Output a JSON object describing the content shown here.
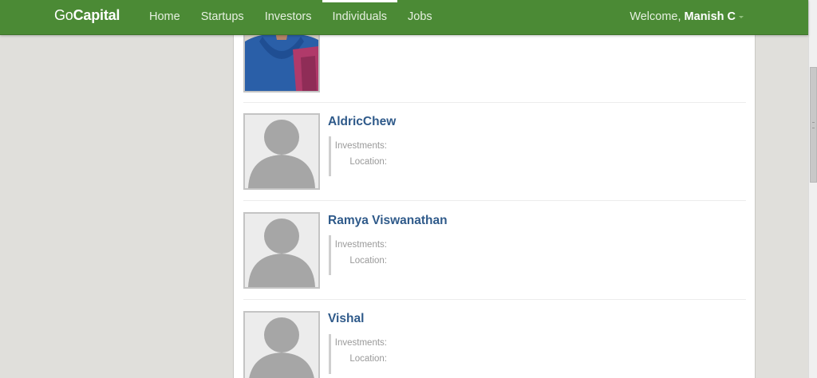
{
  "nav": {
    "brand_prefix": "Go",
    "brand_suffix": "Capital",
    "links": [
      {
        "label": "Home"
      },
      {
        "label": "Startups"
      },
      {
        "label": "Investors"
      },
      {
        "label": "Individuals",
        "active": true
      },
      {
        "label": "Jobs"
      }
    ],
    "welcome_text": "Welcome,",
    "user_name": "Manish C"
  },
  "people": [
    {
      "name": "AldricChew",
      "investments_label": "Investments:",
      "location_label": "Location:"
    },
    {
      "name": "Ramya Viswanathan",
      "investments_label": "Investments:",
      "location_label": "Location:"
    },
    {
      "name": "Vishal",
      "investments_label": "Investments:",
      "location_label": "Location:"
    }
  ]
}
